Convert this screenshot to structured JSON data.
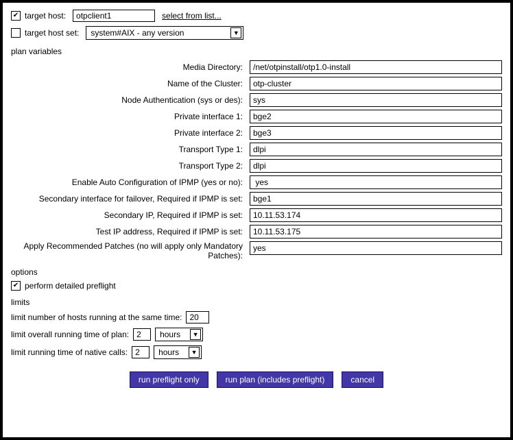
{
  "target_host": {
    "checkbox_checked": true,
    "label": "target host:",
    "value": "otpclient1",
    "link_text": "select from list..."
  },
  "target_host_set": {
    "checkbox_checked": false,
    "label": "target host set:",
    "selected": "system#AIX - any version"
  },
  "sections": {
    "plan_variables_title": "plan variables",
    "options_title": "options",
    "limits_title": "limits"
  },
  "plan_variables": [
    {
      "label": "Media Directory:",
      "value": "/net/otpinstall/otp1.0-install"
    },
    {
      "label": "Name of the Cluster:",
      "value": "otp-cluster"
    },
    {
      "label": "Node Authentication (sys or des):",
      "value": "sys"
    },
    {
      "label": "Private interface 1:",
      "value": "bge2"
    },
    {
      "label": "Private interface 2:",
      "value": "bge3"
    },
    {
      "label": "Transport Type 1:",
      "value": "dlpi"
    },
    {
      "label": "Transport Type 2:",
      "value": "dlpi"
    },
    {
      "label": "Enable Auto Configuration of IPMP (yes or no):",
      "value": " yes"
    },
    {
      "label": "Secondary interface for failover, Required if IPMP is set:",
      "value": "bge1"
    },
    {
      "label": "Secondary IP, Required if IPMP is set:",
      "value": "10.11.53.174"
    },
    {
      "label": "Test IP address, Required if IPMP is set:",
      "value": "10.11.53.175"
    },
    {
      "label": "Apply Recommended Patches (no will apply only Mandatory Patches):",
      "value": "yes"
    }
  ],
  "options": {
    "preflight_checked": true,
    "preflight_label": "perform detailed preflight"
  },
  "limits": {
    "hosts_label": "limit number of hosts running at the same time:",
    "hosts_value": "20",
    "overall_label": "limit overall running time of plan:",
    "overall_value": "2",
    "overall_unit": "hours",
    "native_label": "limit running time of native calls:",
    "native_value": "2",
    "native_unit": "hours"
  },
  "buttons": {
    "run_preflight": "run preflight only",
    "run_plan": "run plan (includes preflight)",
    "cancel": "cancel"
  },
  "glyphs": {
    "check": "✔",
    "down": "▼"
  }
}
